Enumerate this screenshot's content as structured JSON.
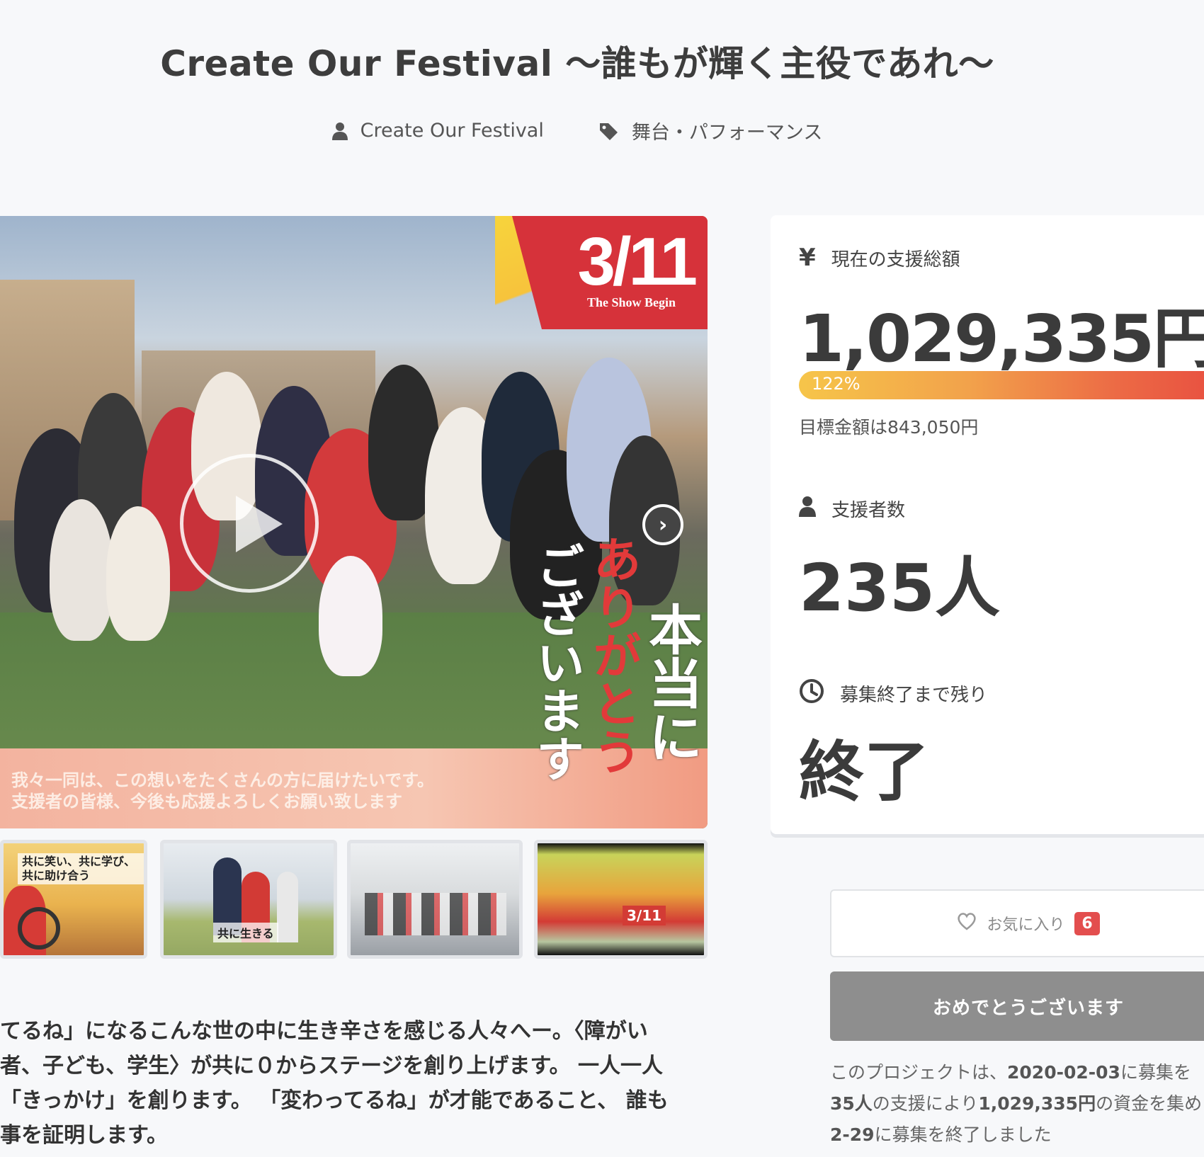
{
  "project": {
    "title": "Create Our Festival 〜誰もが輝く主役であれ〜",
    "owner": "Create Our Festival",
    "category": "舞台・パフォーマンス"
  },
  "main_image": {
    "date_text": "3/11",
    "date_sub": "The Show Begin",
    "vertical_1": "本当に",
    "vertical_2": "ありがとう",
    "vertical_3": "ございます",
    "banner_line1": "我々一同は、この想いをたくさんの方に届けたいです。",
    "banner_line2": "支援者の皆様、今後も応援よろしくお願い致します"
  },
  "thumbnails": [
    {
      "caption": "共に笑い、共に学び、共に助け合う"
    },
    {
      "caption": "共に生きる"
    },
    {
      "caption": ""
    },
    {
      "caption": "3/11"
    }
  ],
  "description": {
    "line1": "てるね」になるこんな世の中に生き辛さを感じる人々へー。〈障がい",
    "line2": "者、子ども、学生〉が共に０からステージを創り上げます。 一人一人",
    "line3": "「きっかけ」を創ります。 「変わってるね」が才能であること、 誰も",
    "line4": "事を証明します。"
  },
  "stats": {
    "raised_label": "現在の支援総額",
    "raised_value": "1,029,335円",
    "progress_text": "122%",
    "progress_percent": 122,
    "goal_text": "目標金額は843,050円",
    "backers_label": "支援者数",
    "backers_value": "235人",
    "remaining_label": "募集終了まで残り",
    "remaining_value": "終了"
  },
  "actions": {
    "favorite_label": "お気に入り",
    "favorite_count": "6",
    "congrats_label": "おめでとうございます"
  },
  "summary": {
    "pre1": "このプロジェクトは、",
    "date1": "2020-02-03",
    "post1": "に募集を",
    "backers": "35人",
    "mid2": "の支援により",
    "amount": "1,029,335円",
    "post2": "の資金を集め",
    "date2": "2-29",
    "post3": "に募集を終了しました"
  },
  "colors": {
    "accent_red": "#e34e4e",
    "progress_start": "#f6c54a",
    "progress_end": "#e84e40"
  }
}
